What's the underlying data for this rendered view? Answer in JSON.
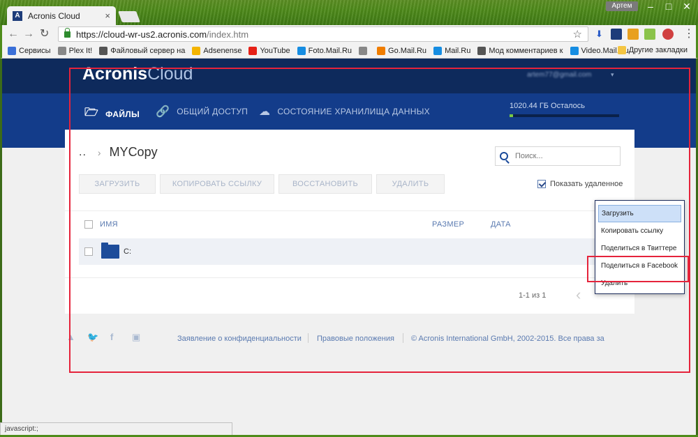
{
  "browser": {
    "tab_title": "Acronis Cloud",
    "tab_close": "×",
    "profile_name": "Артем",
    "url_host": "https://cloud-wr-us2.acronis.com",
    "url_path": "/index.htm",
    "status_text": "javascript:;",
    "bookmarks": [
      {
        "label": "Сервисы",
        "icon": "apps-icon",
        "color": "#3a6fd8"
      },
      {
        "label": "Plex It!",
        "icon": "page-icon",
        "color": "#888888"
      },
      {
        "label": "Файловый сервер на",
        "icon": "portrait-icon",
        "color": "#555555"
      },
      {
        "label": "Adsenense",
        "icon": "adsense-icon",
        "color": "#f4b400"
      },
      {
        "label": "YouTube",
        "icon": "youtube-icon",
        "color": "#e62117"
      },
      {
        "label": "Foto.Mail.Ru",
        "icon": "mailru-icon",
        "color": "#168de2"
      },
      {
        "label": "",
        "icon": "page-icon",
        "color": "#888888"
      },
      {
        "label": "Go.Mail.Ru",
        "icon": "search-bm-icon",
        "color": "#f07d00"
      },
      {
        "label": "Mail.Ru",
        "icon": "mail-icon",
        "color": "#168de2"
      },
      {
        "label": "Мод комментариев к",
        "icon": "portrait-icon",
        "color": "#555555"
      },
      {
        "label": "Video.Mail.Ru",
        "icon": "mailru-icon",
        "color": "#168de2"
      }
    ],
    "other_bookmarks": "Другие закладки"
  },
  "app": {
    "logo_bold": "Acronis",
    "logo_light": "Cloud",
    "user_email": "artem77@gmail.com",
    "nav": [
      {
        "label": "ФАЙЛЫ",
        "icon": "folder-open-icon",
        "active": true
      },
      {
        "label": "ОБЩИЙ ДОСТУП",
        "icon": "link-icon",
        "active": false
      },
      {
        "label": "СОСТОЯНИЕ ХРАНИЛИЩА ДАННЫХ",
        "icon": "cloud-icon",
        "active": false
      }
    ],
    "quota_text": "1020.44 ГБ Осталось",
    "quota_used_fraction": 0.03
  },
  "files": {
    "breadcrumb_up": "..",
    "current_folder": "MYCopy",
    "search_placeholder": "Поиск...",
    "buttons": [
      "ЗАГРУЗИТЬ",
      "КОПИРОВАТЬ ССЫЛКУ",
      "ВОССТАНОВИТЬ",
      "УДАЛИТЬ"
    ],
    "show_deleted_label": "Показать удаленное",
    "show_deleted_checked": true,
    "columns": {
      "name": "ИМЯ",
      "size": "РАЗМЕР",
      "date": "ДАТА"
    },
    "rows": [
      {
        "name": "C:",
        "type": "folder"
      }
    ],
    "pager_text": "1-1 из 1"
  },
  "context_menu": {
    "items": [
      "Загрузить",
      "Копировать ссылку",
      "Поделиться в Твиттере",
      "Поделиться в Facebook",
      "Удалить"
    ],
    "selected_index": 0
  },
  "footer": {
    "privacy": "Заявление о конфиденциальности",
    "legal": "Правовые положения",
    "copyright": "© Acronis International GmbH, 2002-2015. Все права за"
  }
}
